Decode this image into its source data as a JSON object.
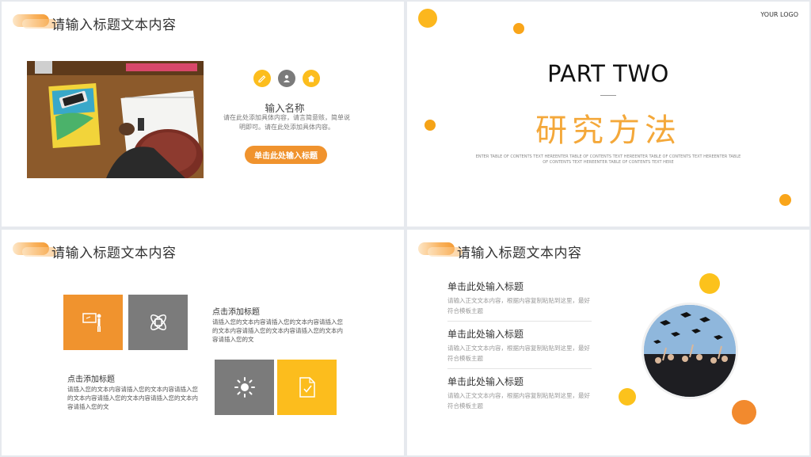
{
  "slide1": {
    "title": "请输入标题文本内容",
    "name": "输入名称",
    "description": "请在此处添加具体内容，请言简意赅，简单说明即可。请在此处添加具体内容。",
    "button": "单击此处输入标题",
    "icons": [
      "pencil-icon",
      "person-icon",
      "house-icon"
    ],
    "colors": {
      "accent": "#f0932e",
      "yellow": "#fcbd1d",
      "gray": "#7b7b7b"
    }
  },
  "slide2": {
    "logo": "YOUR LOGO",
    "part": "PART TWO",
    "heading": "研究方法",
    "subtext": "ENTER TABLE OF CONTENTS TEXT HEREENTER TABLE OF CONTENTS TEXT HEREENTER TABLE OF CONTENTS TEXT HEREENTER TABLE OF CONTENTS TEXT HEREENTER TABLE OF CONTENTS TEXT HERE"
  },
  "slide3": {
    "title": "请输入标题文本内容",
    "block_right": {
      "title": "点击添加标题",
      "body": "请插入您的文本内容请插入您的文本内容请插入您的文本内容请插入您的文本内容请插入您的文本内容请插入您的文"
    },
    "block_left": {
      "title": "点击添加标题",
      "body": "请插入您的文本内容请插入您的文本内容请插入您的文本内容请插入您的文本内容请插入您的文本内容请插入您的文"
    },
    "tiles": [
      "presentation-icon",
      "atom-icon",
      "sun-icon",
      "document-check-icon"
    ]
  },
  "slide4": {
    "title": "请输入标题文本内容",
    "items": [
      {
        "title": "单击此处输入标题",
        "body": "请输入正文文本内容，根据内容复制粘贴到这里，最好符合模板主题"
      },
      {
        "title": "单击此处输入标题",
        "body": "请输入正文文本内容，根据内容复制粘贴到这里，最好符合模板主题"
      },
      {
        "title": "单击此处输入标题",
        "body": "请输入正文文本内容，根据内容复制粘贴到这里，最好符合模板主题"
      }
    ]
  }
}
